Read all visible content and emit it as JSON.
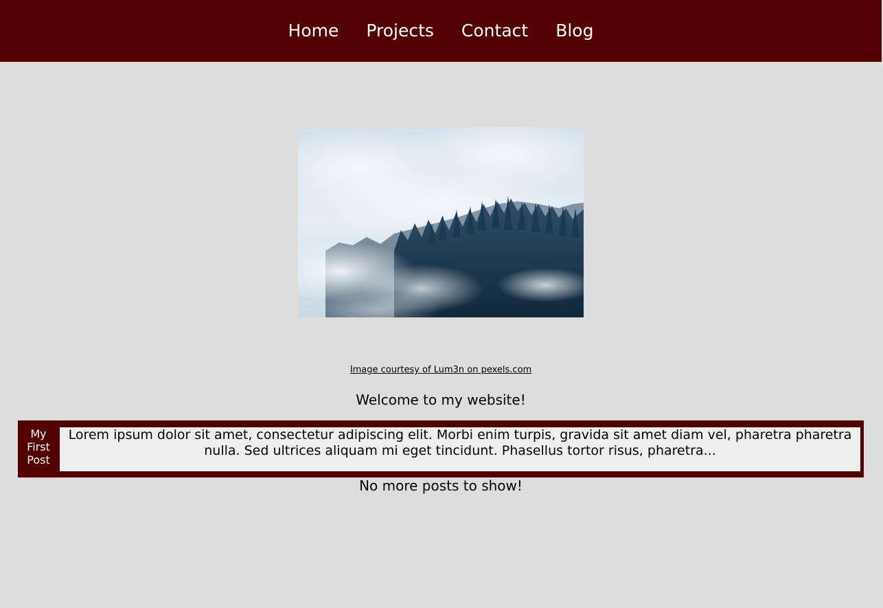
{
  "nav": {
    "items": [
      {
        "label": "Home"
      },
      {
        "label": "Projects"
      },
      {
        "label": "Contact"
      },
      {
        "label": "Blog"
      }
    ]
  },
  "hero": {
    "credit": "Image courtesy of Lum3n on pexels.com"
  },
  "welcome": "Welcome to my website!",
  "posts": [
    {
      "title": "My First Post",
      "excerpt": "Lorem ipsum dolor sit amet, consectetur adipiscing elit. Morbi enim turpis, gravida sit amet diam vel, pharetra pharetra nulla. Sed ultrices aliquam mi eget tincidunt. Phasellus tortor risus, pharetra..."
    }
  ],
  "no_more_posts": "No more posts to show!",
  "colors": {
    "brand": "#520000",
    "background": "#dddddd",
    "post_body": "#eeeeee"
  }
}
